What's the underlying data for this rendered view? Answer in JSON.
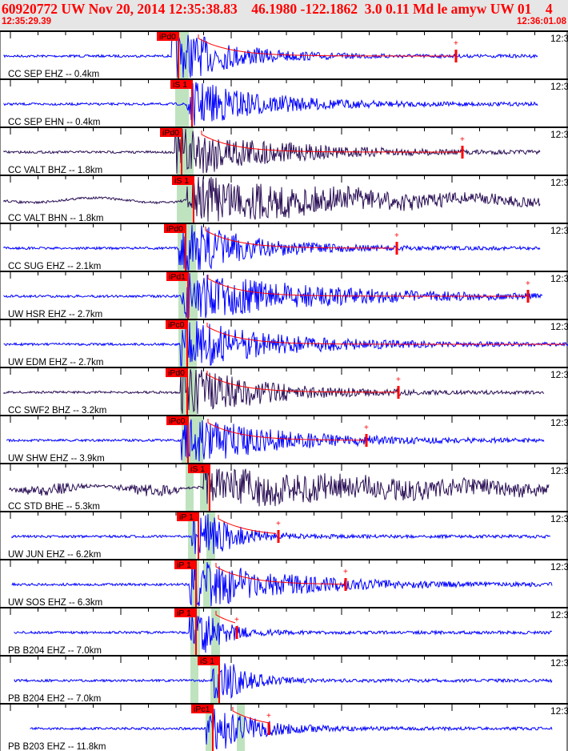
{
  "header": {
    "title": "60920772 UW Nov 20, 2014 12:35:38.83    46.1980 -122.1862  3.0 0.11 Md le amyw UW 01    4",
    "time_start": "12:35:29.39",
    "time_end": "12:36:01.08"
  },
  "colors": {
    "vertical": "#0000ff",
    "broadband": "#2a0f55",
    "pick": "#ff0000",
    "window": "#bfe3bf",
    "coda": "#ff0000"
  },
  "panel_right_label": "12:3",
  "traces": [
    {
      "label": "CC SEP EHZ -- 0.4km",
      "pick": "iPd0"
    },
    {
      "label": "CC SEP EHN -- 0.4km",
      "pick": "iS 1"
    },
    {
      "label": "CC VALT BHZ -- 1.8km",
      "pick": "iPd0"
    },
    {
      "label": "CC VALT BHN -- 1.8km",
      "pick": "iS 1"
    },
    {
      "label": "CC SUG EHZ -- 2.1km",
      "pick": "iPd0"
    },
    {
      "label": "UW HSR EHZ -- 2.7km",
      "pick": "iPd1"
    },
    {
      "label": "UW EDM EHZ -- 2.7km",
      "pick": "iPc0"
    },
    {
      "label": "CC SWF2 BHZ -- 3.2km",
      "pick": "iPd0"
    },
    {
      "label": "UW SHW EHZ -- 3.9km",
      "pick": "iPc0"
    },
    {
      "label": "CC STD BHE -- 5.3km",
      "pick": "iS 1"
    },
    {
      "label": "UW JUN EHZ -- 6.2km",
      "pick": "iP 1"
    },
    {
      "label": "UW SOS EHZ -- 6.3km",
      "pick": "iP 1"
    },
    {
      "label": "PB B204 EHZ -- 7.0km",
      "pick": "iP 1"
    },
    {
      "label": "PB B204 EH2 -- 7.0km",
      "pick": "iS 1"
    },
    {
      "label": "PB B203 EHZ -- 11.8km",
      "pick": "iPc1"
    }
  ]
}
